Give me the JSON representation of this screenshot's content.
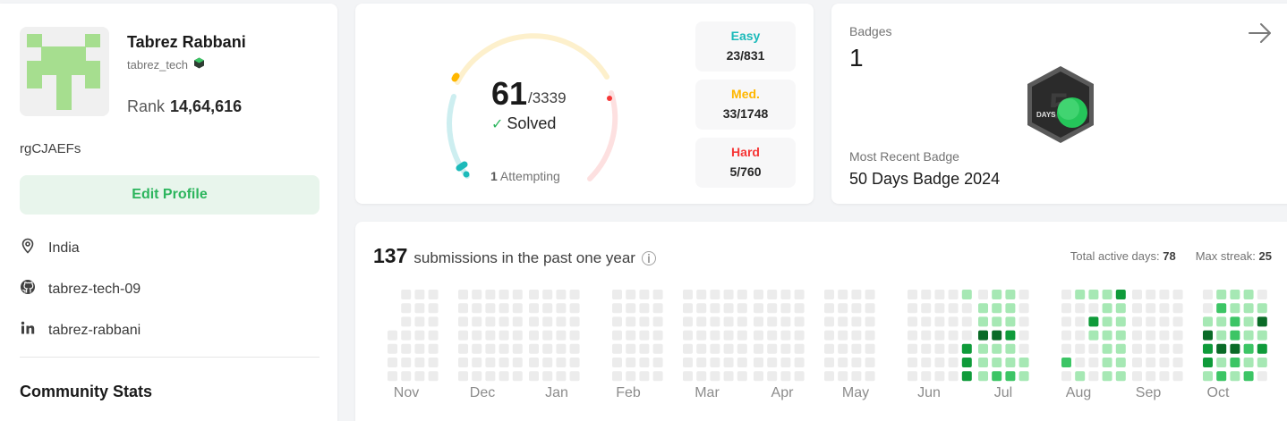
{
  "profile": {
    "name": "Tabrez Rabbani",
    "username": "tabrez_tech",
    "rank_label": "Rank",
    "rank_value": "14,64,616",
    "handle": "rgCJAEFs",
    "edit_button": "Edit Profile",
    "location": "India",
    "github": "tabrez-tech-09",
    "linkedin": "tabrez-rabbani",
    "community_title": "Community Stats"
  },
  "solved": {
    "count": "61",
    "total": "/3339",
    "label": "Solved",
    "attempting_count": "1",
    "attempting_label": "Attempting",
    "difficulties": [
      {
        "label": "Easy",
        "value": "23/831",
        "color": "#1cbaba"
      },
      {
        "label": "Med.",
        "value": "33/1748",
        "color": "#ffb700"
      },
      {
        "label": "Hard",
        "value": "5/760",
        "color": "#f63737"
      }
    ]
  },
  "badges": {
    "title": "Badges",
    "count": "1",
    "icon": "50-days-badge-icon",
    "recent_label": "Most Recent Badge",
    "recent_name": "50 Days Badge 2024",
    "badge_text": "DAYS"
  },
  "calendar": {
    "count": "137",
    "title": "submissions in the past one year",
    "active_days_label": "Total active days:",
    "active_days": "78",
    "max_streak_label": "Max streak:",
    "max_streak": "25",
    "months": [
      "Nov",
      "Dec",
      "Jan",
      "Feb",
      "Mar",
      "Apr",
      "May",
      "Jun",
      "Jul",
      "Aug",
      "Sep",
      "Oct"
    ],
    "colors": {
      "empty": "#ececec",
      "l1": "#a6e8b4",
      "l2": "#3cc565",
      "l3": "#0f9b3a",
      "l4": "#0a6b27"
    }
  }
}
